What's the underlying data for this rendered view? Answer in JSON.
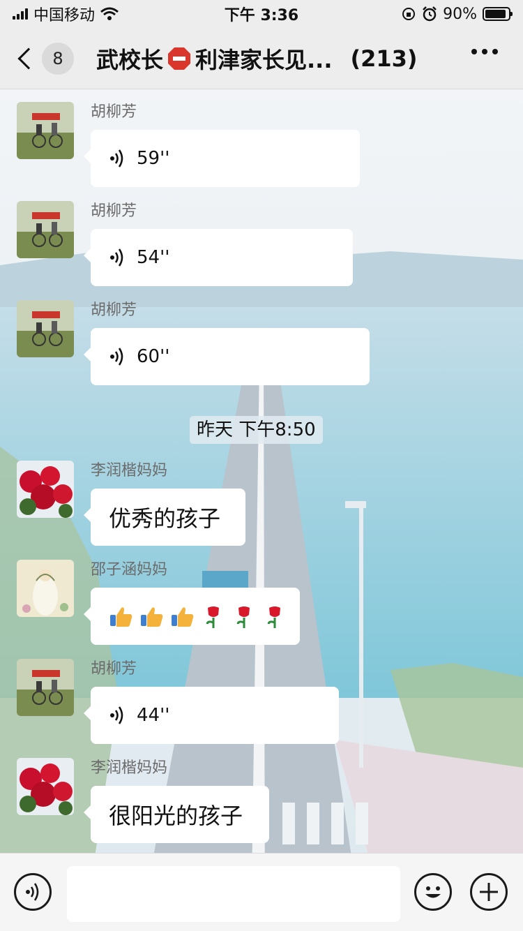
{
  "status_bar": {
    "carrier": "中国移动",
    "time": "下午 3:36",
    "battery_text": "90%",
    "battery_level": 0.9
  },
  "header": {
    "unread_count": "8",
    "title_part1": "武校长",
    "title_part2": "利津家长见...",
    "member_count": "(213)",
    "icons": [
      "back-chevron-icon",
      "stop-sign-icon",
      "more-icon"
    ]
  },
  "messages": [
    {
      "sender": "胡柳芳",
      "type": "voice",
      "duration": "59''"
    },
    {
      "sender": "胡柳芳",
      "type": "voice",
      "duration": "54''"
    },
    {
      "sender": "胡柳芳",
      "type": "voice",
      "duration": "60''"
    },
    {
      "sender": "李润楷妈妈",
      "type": "text",
      "text": "优秀的孩子"
    },
    {
      "sender": "邵子涵妈妈",
      "type": "emoji",
      "emojis": [
        "thumbs-up",
        "thumbs-up",
        "thumbs-up",
        "rose",
        "rose",
        "rose"
      ]
    },
    {
      "sender": "胡柳芳",
      "type": "voice",
      "duration": "44''"
    },
    {
      "sender": "李润楷妈妈",
      "type": "text",
      "text": "很阳光的孩子"
    }
  ],
  "timestamp": "昨天 下午8:50",
  "input_bar": {
    "placeholder": "",
    "icons": [
      "voice-input-icon",
      "emoji-icon",
      "add-icon"
    ]
  },
  "colors": {
    "bar_bg": "#ededed",
    "bubble_bg": "#ffffff",
    "sender_text": "#6b6b6b"
  }
}
